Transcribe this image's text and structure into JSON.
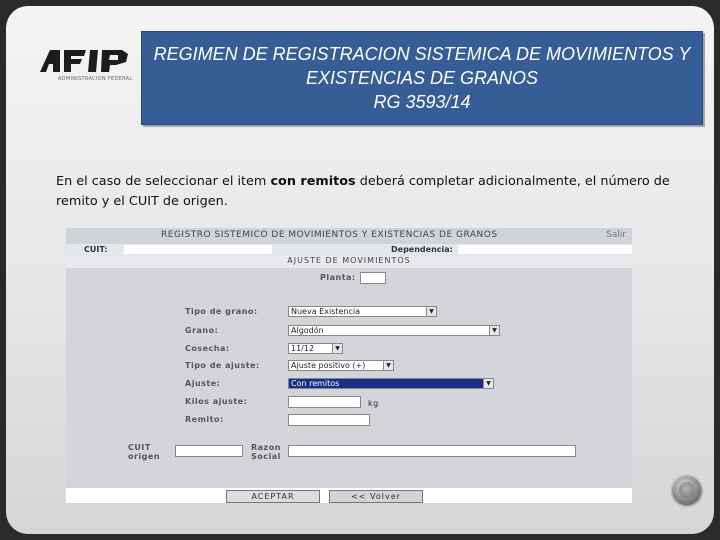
{
  "logo": {
    "text": "AFIP",
    "subtitle": "ADMINISTRACION FEDERAL"
  },
  "header": {
    "title_line1": "REGIMEN DE REGISTRACION SISTEMICA DE MOVIMIENTOS Y",
    "title_line2": "EXISTENCIAS DE GRANOS",
    "title_line3": "RG  3593/14"
  },
  "description": {
    "before": "En el caso de seleccionar el item ",
    "bold": "con remitos",
    "after": " deberá completar adicionalmente, el número de remito y el CUIT de origen."
  },
  "screenshot": {
    "header_title": "REGISTRO SISTEMICO DE MOVIMIENTOS Y EXISTENCIAS DE GRANOS",
    "salir": "Salir",
    "cuit_label": "CUIT:",
    "dependencia_label": "Dependencia:",
    "section_title": "AJUSTE DE MOVIMIENTOS",
    "planta_label": "Planta:",
    "fields": {
      "tipo_grano": {
        "label": "Tipo de grano:",
        "value": "Nueva Existencia"
      },
      "grano": {
        "label": "Grano:",
        "value": "Algodón"
      },
      "cosecha": {
        "label": "Cosecha:",
        "value": "11/12"
      },
      "tipo_ajuste": {
        "label": "Tipo de ajuste:",
        "value": "Ajuste positivo (+)"
      },
      "ajuste": {
        "label": "Ajuste:",
        "value": "Con remitos"
      },
      "kilos_ajuste": {
        "label": "Kilos ajuste:",
        "unit": "kg"
      },
      "remito": {
        "label": "Remito:"
      },
      "cuit_origen": {
        "label1": "CUIT",
        "label2": "origen"
      },
      "razon_social": {
        "label1": "Razon",
        "label2": "Social"
      }
    },
    "buttons": {
      "aceptar": "ACEPTAR",
      "volver": "<< Volver"
    }
  }
}
